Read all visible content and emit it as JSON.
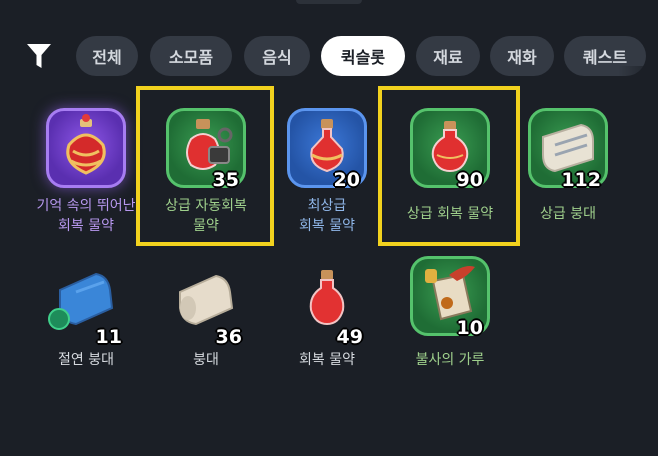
{
  "filter_tabs": [
    {
      "label": "전체",
      "active": false
    },
    {
      "label": "소모품",
      "active": false
    },
    {
      "label": "음식",
      "active": false
    },
    {
      "label": "퀵슬롯",
      "active": true
    },
    {
      "label": "재료",
      "active": false
    },
    {
      "label": "재화",
      "active": false
    },
    {
      "label": "퀘스트",
      "active": false
    }
  ],
  "items": [
    {
      "name": "기억 속의 뛰어난 회복 물약",
      "line1": "기억 속의 뛰어난",
      "line2": "회복 물약",
      "qty": "",
      "frame": "purple",
      "highlighted": false
    },
    {
      "name": "상급 자동회복 물약",
      "line1": "상급 자동회복",
      "line2": "물약",
      "qty": "35",
      "frame": "green",
      "highlighted": true
    },
    {
      "name": "최상급 회복 물약",
      "line1": "최상급",
      "line2": "회복 물약",
      "qty": "20",
      "frame": "blue",
      "highlighted": false
    },
    {
      "name": "상급 회복 물약",
      "line1": "상급 회복 물약",
      "line2": "",
      "qty": "90",
      "frame": "green",
      "highlighted": true
    },
    {
      "name": "상급 붕대",
      "line1": "상급 붕대",
      "line2": "",
      "qty": "112",
      "frame": "green",
      "highlighted": false
    },
    {
      "name": "절연 붕대",
      "line1": "절연 붕대",
      "line2": "",
      "qty": "11",
      "frame": "none",
      "highlighted": false
    },
    {
      "name": "붕대",
      "line1": "붕대",
      "line2": "",
      "qty": "36",
      "frame": "none",
      "highlighted": false
    },
    {
      "name": "회복 물약",
      "line1": "회복 물약",
      "line2": "",
      "qty": "49",
      "frame": "none",
      "highlighted": false
    },
    {
      "name": "불사의 가루",
      "line1": "불사의 가루",
      "line2": "",
      "qty": "10",
      "frame": "green",
      "highlighted": false
    }
  ],
  "colors": {
    "background": "#1b1f26",
    "tab_inactive": "#343a44",
    "tab_active": "#ffffff",
    "highlight": "#f2d21e",
    "label_green": "#9fd08c",
    "label_blue": "#8fb6e8",
    "label_purple": "#b798ef",
    "label_gray": "#d6dadf"
  },
  "icons": {
    "filter": "funnel-icon",
    "shop_badge": "basket-badge-icon"
  }
}
